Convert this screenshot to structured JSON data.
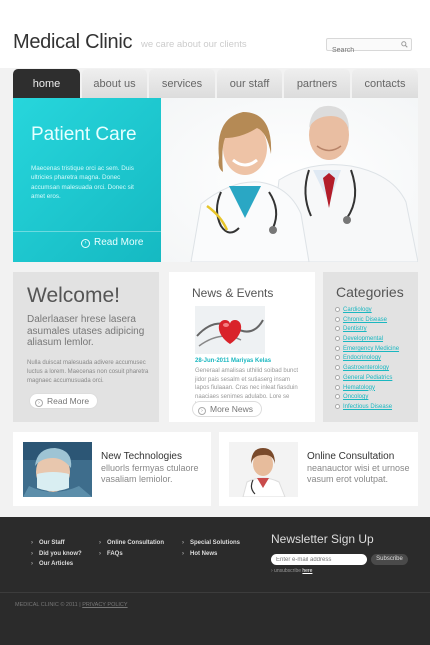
{
  "header": {
    "logo": "Medical Clinic",
    "slogan": "we care about our clients",
    "search_placeholder": "Search"
  },
  "nav": {
    "tabs": [
      {
        "label": "home",
        "active": true
      },
      {
        "label": "about us",
        "active": false
      },
      {
        "label": "services",
        "active": false
      },
      {
        "label": "our staff",
        "active": false
      },
      {
        "label": "partners",
        "active": false
      },
      {
        "label": "contacts",
        "active": false
      }
    ]
  },
  "hero": {
    "title": "Patient Care",
    "text": "Maecenas tristique orci ac sem. Duis ultricies pharetra magna. Donec accumsan malesuada orci. Donec sit amet eros.",
    "more": "Read More",
    "accent": "#1ec7ce"
  },
  "welcome": {
    "title": "Welcome!",
    "lead": "Dalerlaaser hrese lasera asumales utases adipicing aliasum lemlor.",
    "text": "Nulla duiscat malesuada adivere accumusec luctus a lorem. Maecenas non cosuit pharetra magnaec accumusuada orci.",
    "more": "Read More"
  },
  "news": {
    "title": "News & Events",
    "date": "28-Jun-2011 Mariyas Kelas",
    "text": "Generaal amalisas uthilid soibad bunct jidor pais sesalm et sutiaserg insam lapos fiulaaan. Cras nec inleat fiasduin naaciaes senimes adulabo. Lore se luctus.",
    "more": "More News"
  },
  "categories": {
    "title": "Categories",
    "items": [
      "Cardiology",
      "Chronic Disease",
      "Dentistry",
      "Developmental",
      "Emergency Medicine",
      "Endocrinology",
      "Gastroenterology",
      "General Pediatrics",
      "Hematology",
      "Oncology",
      "Infectious Disease"
    ]
  },
  "features": [
    {
      "title": "New Technologies",
      "text": "elluorls fermyas ctulaore vasaliam lemiolor."
    },
    {
      "title": "Online Consultation",
      "text": "neanauctor wisi et urnose vasum erot volutpat."
    }
  ],
  "footer": {
    "col1": [
      "Our Staff",
      "Did you know?",
      "Our Articles"
    ],
    "col2": [
      "Online Consultation",
      "FAQs"
    ],
    "col3": [
      "Special Solutions",
      "Hot News"
    ],
    "newsletter_title": "Newsletter Sign Up",
    "email_placeholder": "Enter e-mail address",
    "subscribe": "Subscribe",
    "unsubscribe_prefix": "› unsubscribe",
    "unsubscribe_link": "here",
    "copyright": "MEDICAL CLINIC © 2011 |",
    "privacy": "PRIVACY POLICY"
  }
}
